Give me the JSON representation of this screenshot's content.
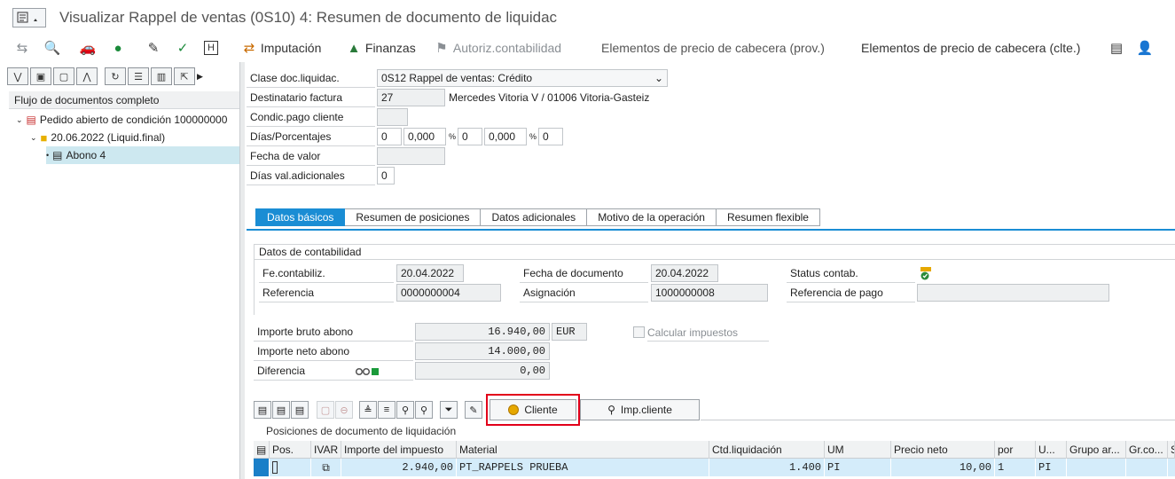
{
  "window": {
    "title": "Visualizar Rappel de ventas (0S10) 4: Resumen de documento de liquidac"
  },
  "toolbar": {
    "imputacion": "Imputación",
    "finanzas": "Finanzas",
    "autoriz": "Autoriz.contabilidad",
    "elem_prov": "Elementos de precio de cabecera (prov.)",
    "elem_clte": "Elementos de precio de cabecera (clte.)"
  },
  "tree": {
    "header": "Flujo de documentos completo",
    "items": [
      {
        "label": "Pedido abierto de condición 100000000"
      },
      {
        "label": "20.06.2022 (Liquid.final)"
      },
      {
        "label": "Abono 4"
      }
    ]
  },
  "header_form": {
    "clase_label": "Clase doc.liquidac.",
    "clase_value": "0S12 Rappel de ventas: Crédito",
    "dest_label": "Destinatario factura",
    "dest_value": "27",
    "dest_text": "Mercedes Vitoria V / 01006 Vitoria-Gasteiz",
    "condic_label": "Condic.pago cliente",
    "dias_label": "Días/Porcentajes",
    "dias_1": "0",
    "pct_1": "0,000",
    "pct_sym_1": "%",
    "dias_2": "0",
    "pct_2": "0,000",
    "pct_sym_2": "%",
    "dias_3": "0",
    "fecha_valor_label": "Fecha de valor",
    "dias_val_label": "Días val.adicionales",
    "dias_val_value": "0"
  },
  "tabs": [
    {
      "label": "Datos básicos",
      "active": true
    },
    {
      "label": "Resumen de posiciones"
    },
    {
      "label": "Datos adicionales"
    },
    {
      "label": "Motivo de la operación"
    },
    {
      "label": "Resumen flexible"
    }
  ],
  "contab": {
    "group_title": "Datos de contabilidad",
    "fe_contab_label": "Fe.contabiliz.",
    "fe_contab_value": "20.04.2022",
    "fecha_doc_label": "Fecha de documento",
    "fecha_doc_value": "20.04.2022",
    "status_label": "Status contab.",
    "referencia_label": "Referencia",
    "referencia_value": "0000000004",
    "asignacion_label": "Asignación",
    "asignacion_value": "1000000008",
    "ref_pago_label": "Referencia de pago"
  },
  "importes": {
    "bruto_label": "Importe bruto abono",
    "bruto_value": "16.940,00",
    "moneda": "EUR",
    "calc_label": "Calcular impuestos",
    "neto_label": "Importe neto abono",
    "neto_value": "14.000,00",
    "dif_label": "Diferencia",
    "dif_value": "0,00"
  },
  "item_buttons": {
    "cliente": "Cliente",
    "imp_cliente": "Imp.cliente"
  },
  "positions": {
    "title": "Posiciones de documento de liquidación",
    "columns": [
      "Pos.",
      "IVAR",
      "Importe del impuesto",
      "Material",
      "Ctd.liquidación",
      "UM",
      "Precio neto",
      "por",
      "U...",
      "Grupo ar...",
      "Gr.co...",
      "S"
    ],
    "rows": [
      {
        "importe": "2.940,00",
        "material": "PT_RAPPELS PRUEBA",
        "ctd": "1.400",
        "um": "PI",
        "precio": "10,00",
        "por": "1",
        "u": "PI"
      }
    ]
  }
}
